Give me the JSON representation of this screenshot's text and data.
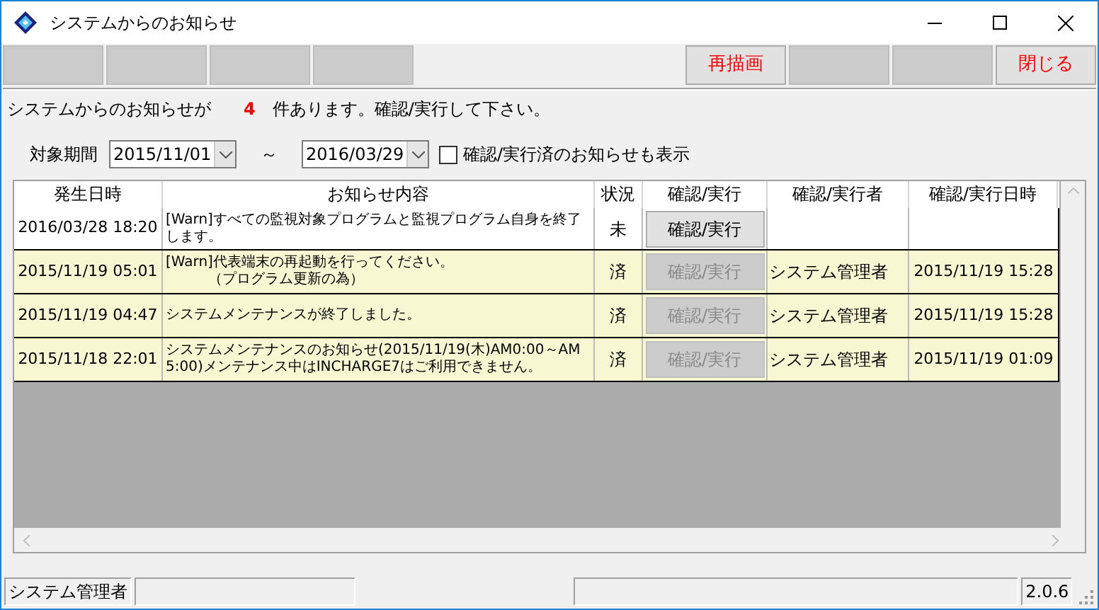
{
  "window": {
    "title": "システムからのお知らせ"
  },
  "toolbar": [
    {
      "kind": "blank"
    },
    {
      "kind": "blank"
    },
    {
      "kind": "blank"
    },
    {
      "kind": "blank"
    },
    {
      "kind": "spacer"
    },
    {
      "kind": "button",
      "label": "再描画"
    },
    {
      "kind": "blank"
    },
    {
      "kind": "blank"
    },
    {
      "kind": "button",
      "label": "閉じる"
    }
  ],
  "message": {
    "before": "システムからのお知らせが",
    "count": "4",
    "after": "件あります。確認/実行して下さい。"
  },
  "filter": {
    "label": "対象期間",
    "from": "2015/11/01",
    "separator": "～",
    "to": "2016/03/29",
    "show_done": {
      "label": "確認/実行済のお知らせも表示",
      "checked": false
    }
  },
  "table": {
    "columns": [
      "発生日時",
      "お知らせ内容",
      "状況",
      "確認/実行",
      "確認/実行者",
      "確認/実行日時"
    ],
    "rows": [
      {
        "date": "2016/03/28 18:20",
        "content": [
          "[Warn]すべての監視対象プログラムと監視プログラム自身を終了します。"
        ],
        "status": "未",
        "action": "確認/実行",
        "confirmed": false
      },
      {
        "date": "2015/11/19 05:01",
        "content": [
          "[Warn]代表端末の再起動を行ってください。",
          "　　　（プログラム更新の為）"
        ],
        "status": "済",
        "action": "確認/実行",
        "confirmed": true,
        "by": "システム管理者",
        "at": "2015/11/19 15:28"
      },
      {
        "date": "2015/11/19 04:47",
        "content": [
          "システムメンテナンスが終了しました。"
        ],
        "status": "済",
        "action": "確認/実行",
        "confirmed": true,
        "by": "システム管理者",
        "at": "2015/11/19 15:28"
      },
      {
        "date": "2015/11/18 22:01",
        "content": [
          "システムメンテナンスのお知らせ(2015/11/19(木)AM0:00～AM5:00)メンテナンス中はINCHARGE7はご利用できません。"
        ],
        "status": "済",
        "action": "確認/実行",
        "confirmed": true,
        "by": "システム管理者",
        "at": "2015/11/19 01:09"
      }
    ]
  },
  "status_bar": {
    "user": "システム管理者",
    "version": "2.0.6"
  }
}
